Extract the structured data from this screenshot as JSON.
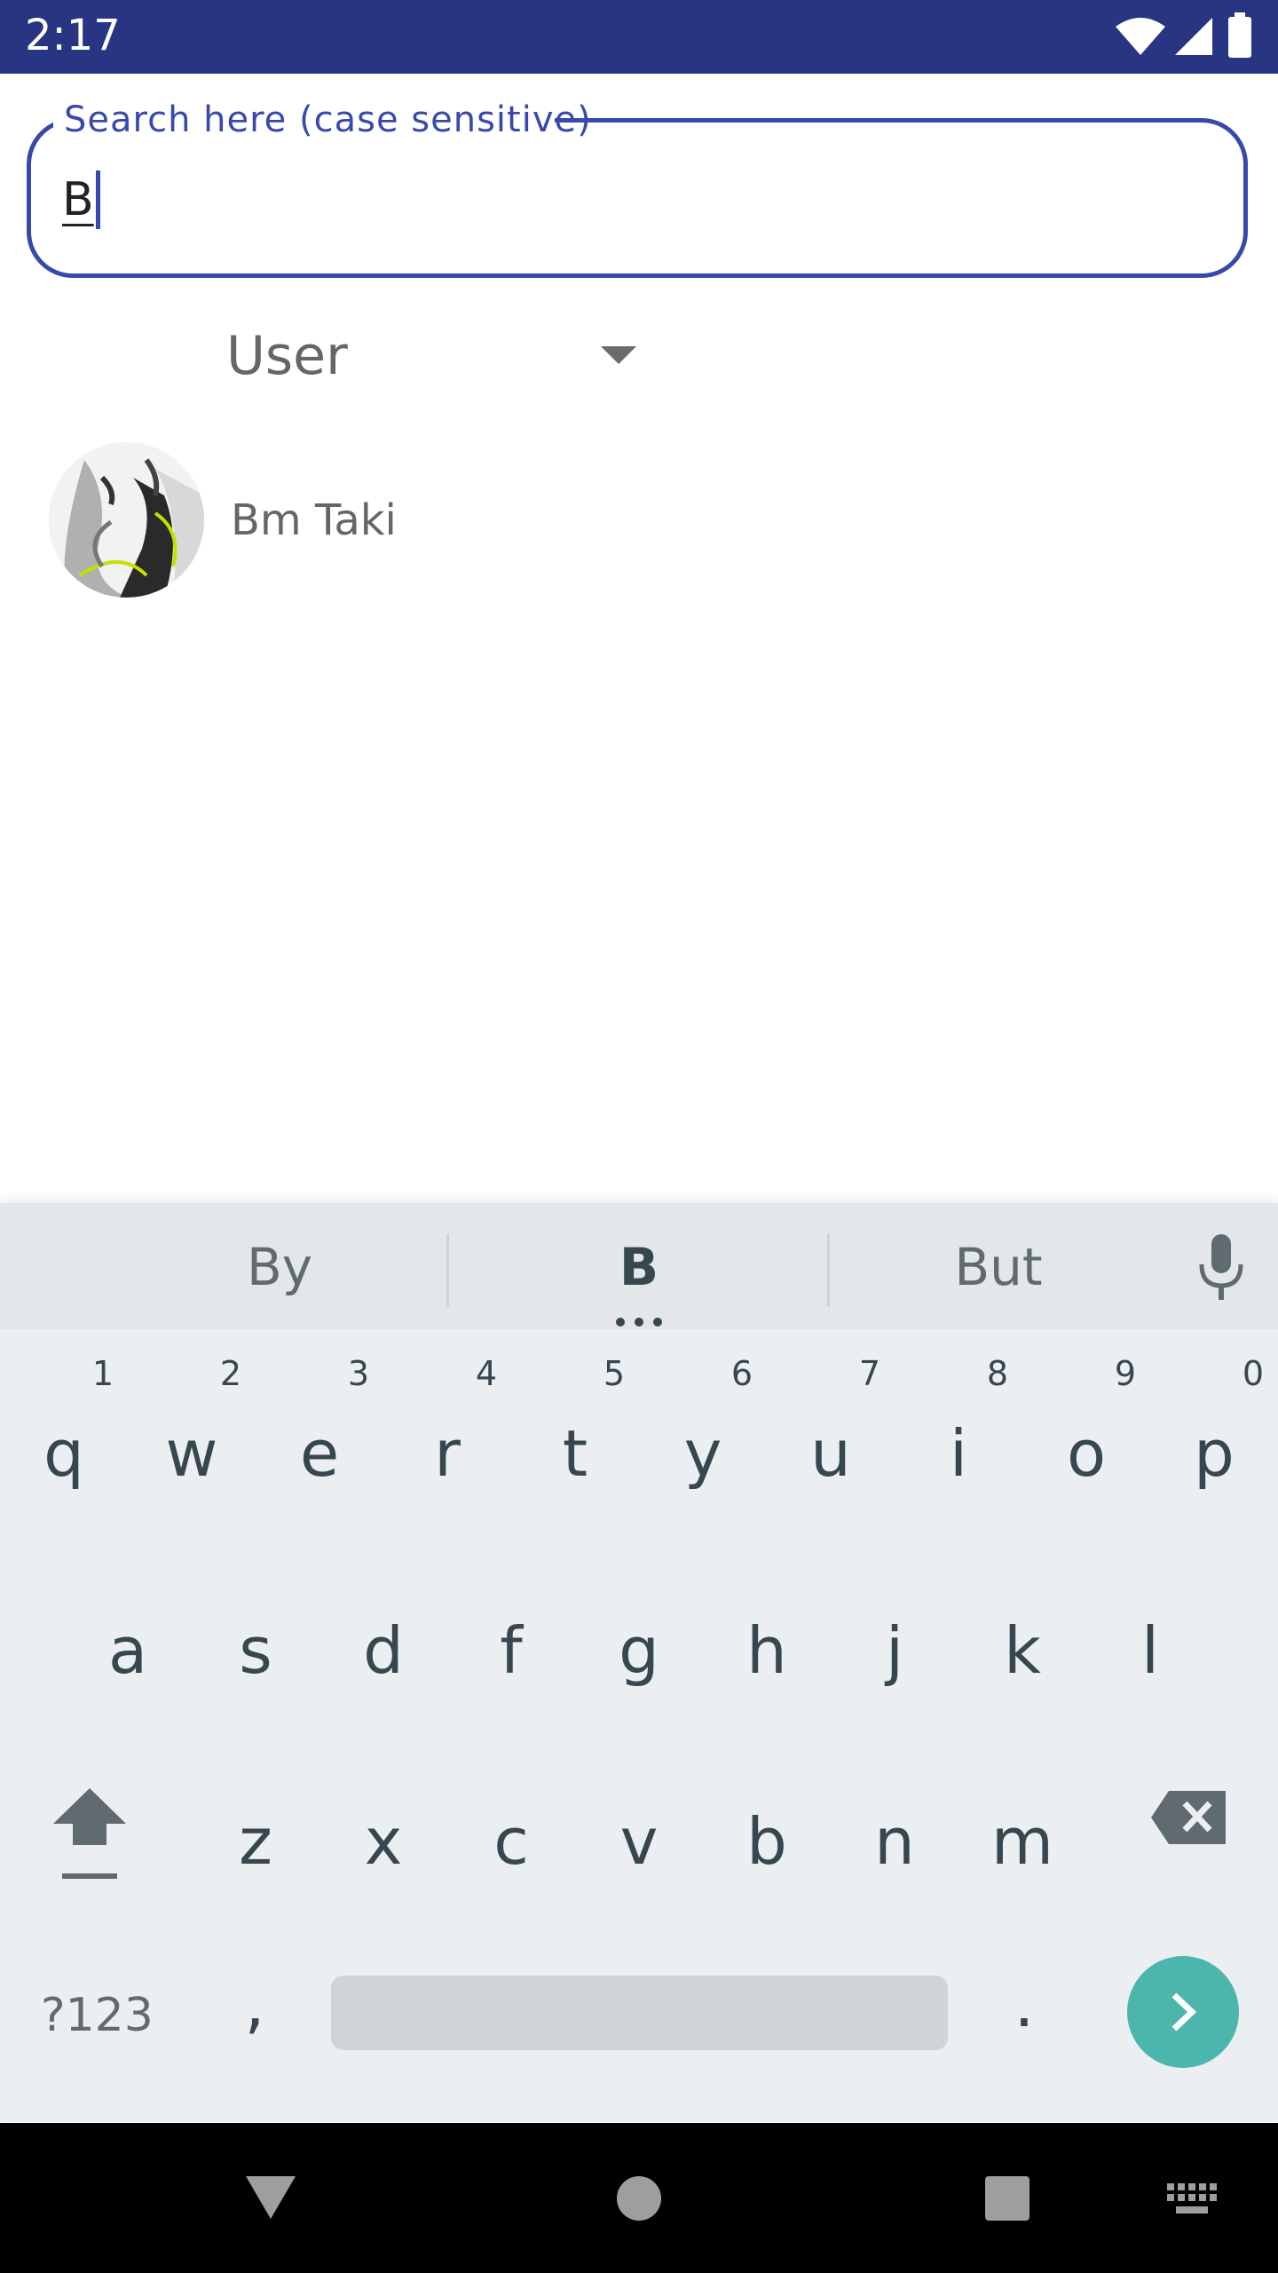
{
  "status_bar": {
    "time": "2:17"
  },
  "search": {
    "label": "Search here (case sensitive)",
    "value": "B"
  },
  "dropdown": {
    "selected": "User"
  },
  "results": [
    {
      "name": "Bm Taki"
    }
  ],
  "keyboard": {
    "suggestions": [
      "By",
      "B",
      "But"
    ],
    "row1": [
      "q",
      "w",
      "e",
      "r",
      "t",
      "y",
      "u",
      "i",
      "o",
      "p"
    ],
    "row1_hints": [
      "1",
      "2",
      "3",
      "4",
      "5",
      "6",
      "7",
      "8",
      "9",
      "0"
    ],
    "row2": [
      "a",
      "s",
      "d",
      "f",
      "g",
      "h",
      "j",
      "k",
      "l"
    ],
    "row3": [
      "z",
      "x",
      "c",
      "v",
      "b",
      "n",
      "m"
    ],
    "symbols_label": "?123",
    "comma": ",",
    "period": "."
  },
  "colors": {
    "status_bar": "#283583",
    "accent": "#3949ab",
    "enter": "#4db6ac"
  }
}
